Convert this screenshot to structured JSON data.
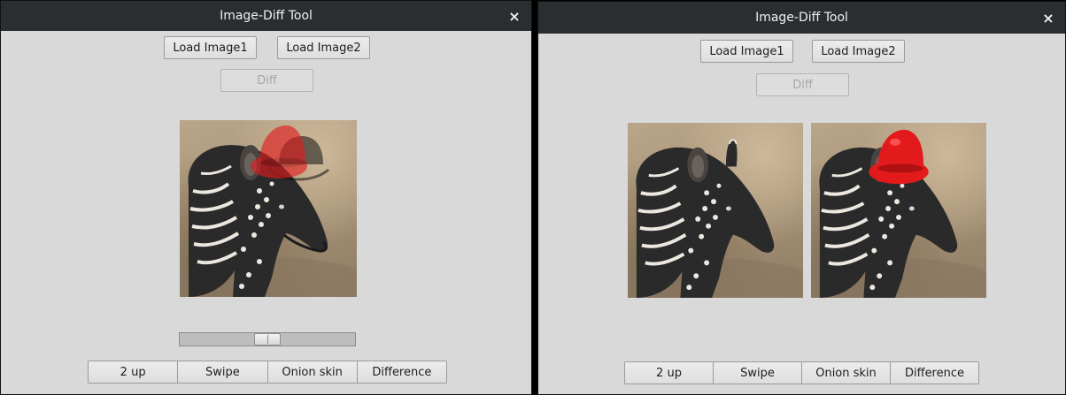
{
  "left_window": {
    "title": "Image-Diff Tool",
    "close_icon": "×",
    "load1_label": "Load Image1",
    "load2_label": "Load Image2",
    "diff_label": "Diff",
    "slider": {
      "value": 0.5
    },
    "modes": [
      "2 up",
      "Swipe",
      "Onion skin",
      "Difference"
    ]
  },
  "right_window": {
    "title": "Image-Diff Tool",
    "close_icon": "×",
    "load1_label": "Load Image1",
    "load2_label": "Load Image2",
    "diff_label": "Diff",
    "modes": [
      "2 up",
      "Swipe",
      "Onion skin",
      "Difference"
    ]
  },
  "icons": {
    "close": "close-icon"
  },
  "colors": {
    "titlebar_bg": "#2b2e30",
    "window_bg": "#d9d9d9",
    "hat_red": "#e31a1c"
  }
}
